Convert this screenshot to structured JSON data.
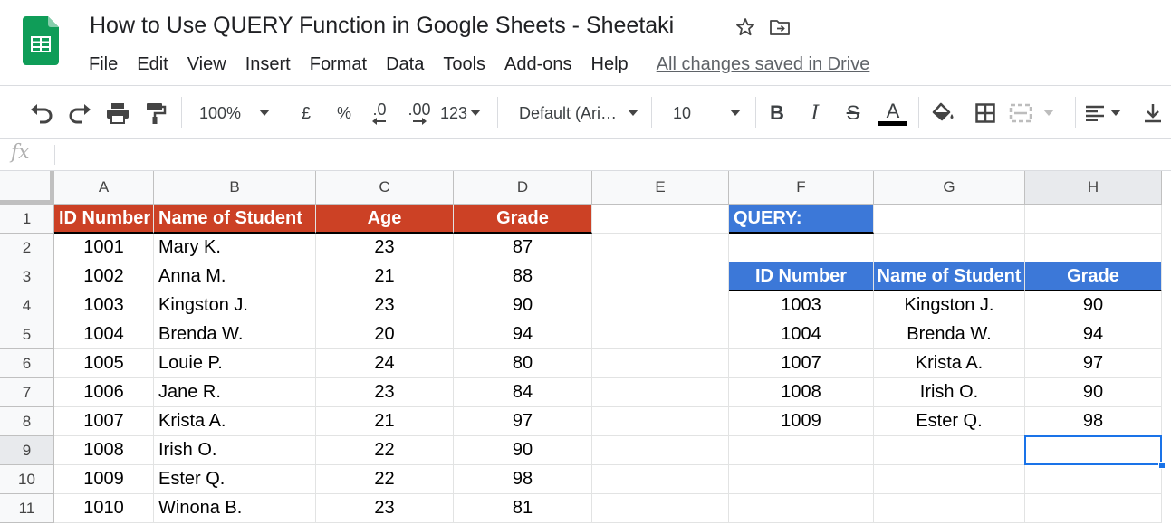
{
  "document": {
    "title": "How to Use QUERY Function in Google Sheets - Sheetaki",
    "save_status": "All changes saved in Drive"
  },
  "menu": [
    "File",
    "Edit",
    "View",
    "Insert",
    "Format",
    "Data",
    "Tools",
    "Add-ons",
    "Help"
  ],
  "toolbar": {
    "zoom": "100%",
    "currency": "£",
    "percent": "%",
    "decimal_decrease": ".0",
    "decimal_increase": ".00",
    "number_format": "123",
    "font": "Default (Ari…",
    "font_size": "10",
    "bold": "B",
    "italic": "I",
    "strike": "S",
    "text_color": "A",
    "text_color_value": "#000000"
  },
  "formula_bar": {
    "fx_label": "fx",
    "value": ""
  },
  "columns": [
    "A",
    "B",
    "C",
    "D",
    "E",
    "F",
    "G",
    "H"
  ],
  "rows": [
    "1",
    "2",
    "3",
    "4",
    "5",
    "6",
    "7",
    "8",
    "9",
    "10",
    "11"
  ],
  "source_table": {
    "headers": [
      "ID Number",
      "Name of Student",
      "Age",
      "Grade"
    ],
    "header_color": "#cc4125",
    "rows": [
      [
        "1001",
        "Mary K.",
        "23",
        "87"
      ],
      [
        "1002",
        "Anna M.",
        "21",
        "88"
      ],
      [
        "1003",
        "Kingston J.",
        "23",
        "90"
      ],
      [
        "1004",
        "Brenda W.",
        "20",
        "94"
      ],
      [
        "1005",
        "Louie P.",
        "24",
        "80"
      ],
      [
        "1006",
        "Jane R.",
        "23",
        "84"
      ],
      [
        "1007",
        "Krista A.",
        "21",
        "97"
      ],
      [
        "1008",
        "Irish O.",
        "22",
        "90"
      ],
      [
        "1009",
        "Ester Q.",
        "22",
        "98"
      ],
      [
        "1010",
        "Winona B.",
        "23",
        "81"
      ]
    ]
  },
  "query_label": "QUERY:",
  "query_color": "#3c78d8",
  "result_table": {
    "headers": [
      "ID Number",
      "Name of Student",
      "Grade"
    ],
    "rows": [
      [
        "1003",
        "Kingston J.",
        "90"
      ],
      [
        "1004",
        "Brenda W.",
        "94"
      ],
      [
        "1007",
        "Krista A.",
        "97"
      ],
      [
        "1008",
        "Irish O.",
        "90"
      ],
      [
        "1009",
        "Ester Q.",
        "98"
      ]
    ]
  },
  "selected_cell": "H9"
}
